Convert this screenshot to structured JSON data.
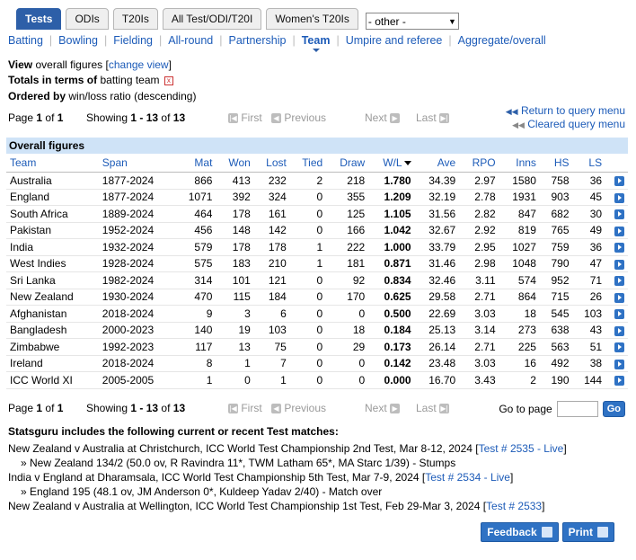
{
  "tabs": [
    {
      "label": "Tests",
      "active": true
    },
    {
      "label": "ODIs",
      "active": false
    },
    {
      "label": "T20Is",
      "active": false
    },
    {
      "label": "All Test/ODI/T20I",
      "active": false
    },
    {
      "label": "Women's T20Is",
      "active": false
    }
  ],
  "other_select": "- other -",
  "subnav": [
    "Batting",
    "Bowling",
    "Fielding",
    "All-round",
    "Partnership",
    "Team",
    "Umpire and referee",
    "Aggregate/overall"
  ],
  "subnav_current": "Team",
  "view": {
    "label": "View",
    "value": "overall figures",
    "change": "change view"
  },
  "totals": {
    "label": "Totals in terms of",
    "value": "batting team"
  },
  "ordered": {
    "label": "Ordered by",
    "value": "win/loss ratio (descending)"
  },
  "pager": {
    "page_label": "Page",
    "page": "1",
    "of": "of",
    "pages": "1",
    "showing": "Showing",
    "range": "1 - 13",
    "of2": "of",
    "total": "13",
    "first": "First",
    "previous": "Previous",
    "next": "Next",
    "last": "Last"
  },
  "query": {
    "return": "Return to query menu",
    "cleared": "Cleared query menu"
  },
  "table": {
    "caption": "Overall figures",
    "columns": [
      "Team",
      "Span",
      "Mat",
      "Won",
      "Lost",
      "Tied",
      "Draw",
      "W/L",
      "Ave",
      "RPO",
      "Inns",
      "HS",
      "LS"
    ],
    "rows": [
      [
        "Australia",
        "1877-2024",
        "866",
        "413",
        "232",
        "2",
        "218",
        "1.780",
        "34.39",
        "2.97",
        "1580",
        "758",
        "36"
      ],
      [
        "England",
        "1877-2024",
        "1071",
        "392",
        "324",
        "0",
        "355",
        "1.209",
        "32.19",
        "2.78",
        "1931",
        "903",
        "45"
      ],
      [
        "South Africa",
        "1889-2024",
        "464",
        "178",
        "161",
        "0",
        "125",
        "1.105",
        "31.56",
        "2.82",
        "847",
        "682",
        "30"
      ],
      [
        "Pakistan",
        "1952-2024",
        "456",
        "148",
        "142",
        "0",
        "166",
        "1.042",
        "32.67",
        "2.92",
        "819",
        "765",
        "49"
      ],
      [
        "India",
        "1932-2024",
        "579",
        "178",
        "178",
        "1",
        "222",
        "1.000",
        "33.79",
        "2.95",
        "1027",
        "759",
        "36"
      ],
      [
        "West Indies",
        "1928-2024",
        "575",
        "183",
        "210",
        "1",
        "181",
        "0.871",
        "31.46",
        "2.98",
        "1048",
        "790",
        "47"
      ],
      [
        "Sri Lanka",
        "1982-2024",
        "314",
        "101",
        "121",
        "0",
        "92",
        "0.834",
        "32.46",
        "3.11",
        "574",
        "952",
        "71"
      ],
      [
        "New Zealand",
        "1930-2024",
        "470",
        "115",
        "184",
        "0",
        "170",
        "0.625",
        "29.58",
        "2.71",
        "864",
        "715",
        "26"
      ],
      [
        "Afghanistan",
        "2018-2024",
        "9",
        "3",
        "6",
        "0",
        "0",
        "0.500",
        "22.69",
        "3.03",
        "18",
        "545",
        "103"
      ],
      [
        "Bangladesh",
        "2000-2023",
        "140",
        "19",
        "103",
        "0",
        "18",
        "0.184",
        "25.13",
        "3.14",
        "273",
        "638",
        "43"
      ],
      [
        "Zimbabwe",
        "1992-2023",
        "117",
        "13",
        "75",
        "0",
        "29",
        "0.173",
        "26.14",
        "2.71",
        "225",
        "563",
        "51"
      ],
      [
        "Ireland",
        "2018-2024",
        "8",
        "1",
        "7",
        "0",
        "0",
        "0.142",
        "23.48",
        "3.03",
        "16",
        "492",
        "38"
      ],
      [
        "ICC World XI",
        "2005-2005",
        "1",
        "0",
        "1",
        "0",
        "0",
        "0.000",
        "16.70",
        "3.43",
        "2",
        "190",
        "144"
      ]
    ]
  },
  "goto": {
    "label": "Go to page",
    "button": "Go"
  },
  "matches": {
    "head": "Statsguru includes the following current or recent Test matches:",
    "items": [
      {
        "text": "New Zealand v Australia at Christchurch, ICC World Test Championship 2nd Test, Mar 8-12, 2024 [",
        "link": "Test # 2535 - Live",
        "end": "]",
        "sub": "» New Zealand 134/2 (50.0 ov, R Ravindra 11*, TWM Latham 65*, MA Starc 1/39) - Stumps"
      },
      {
        "text": "India v England at Dharamsala, ICC World Test Championship 5th Test, Mar 7-9, 2024 [",
        "link": "Test # 2534 - Live",
        "end": "]",
        "sub": "» England 195 (48.1 ov, JM Anderson 0*, Kuldeep Yadav 2/40) - Match over"
      },
      {
        "text": "New Zealand v Australia at Wellington, ICC World Test Championship 1st Test, Feb 29-Mar 3, 2024 [",
        "link": "Test # 2533",
        "end": "]",
        "sub": ""
      }
    ]
  },
  "buttons": {
    "feedback": "Feedback",
    "print": "Print"
  }
}
